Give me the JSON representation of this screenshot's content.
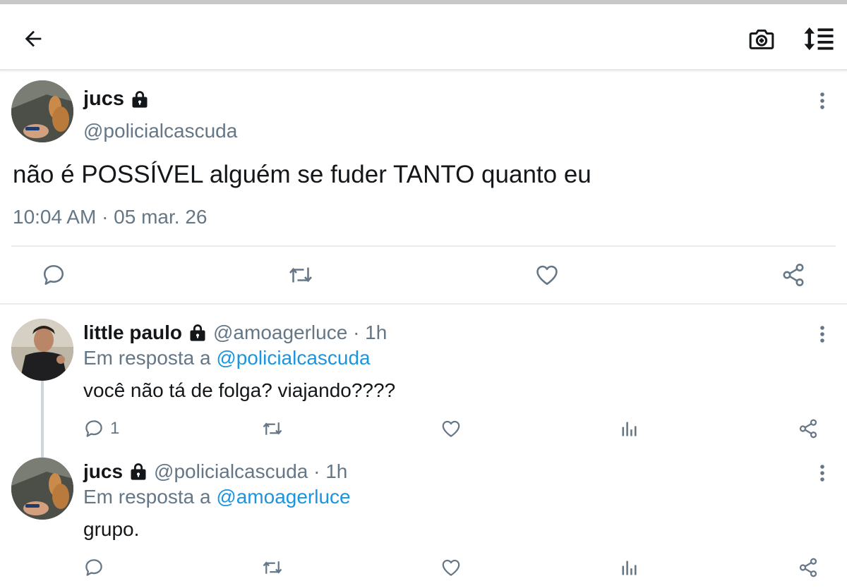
{
  "header": {
    "back_icon": "arrow-left-icon",
    "camera_icon": "camera-plus-icon",
    "sort_icon": "sort-list-icon"
  },
  "main_tweet": {
    "name": "jucs",
    "handle": "@policialcascuda",
    "text": "não é POSSÍVEL alguém se fuder TANTO quanto eu",
    "time": "10:04 AM · 05 mar. 26",
    "protected_icon": "lock-icon",
    "actions": [
      "reply-icon",
      "retweet-icon",
      "like-icon",
      "share-icon"
    ]
  },
  "replies": [
    {
      "name": "little paulo",
      "handle": "@amoagerluce · 1h",
      "in_reply_prefix": "Em resposta a",
      "in_reply_to": "@policialcascuda",
      "text": "você não tá de folga? viajando????",
      "reply_count": "1"
    },
    {
      "name": "jucs",
      "handle": "@policialcascuda · 1h",
      "in_reply_prefix": "Em resposta a",
      "in_reply_to": "@amoagerluce",
      "text": "grupo.",
      "reply_count": ""
    }
  ],
  "colors": {
    "text": "#14171a",
    "secondary": "#657786",
    "link": "#1b95e0",
    "divider": "#e6ecf0"
  }
}
